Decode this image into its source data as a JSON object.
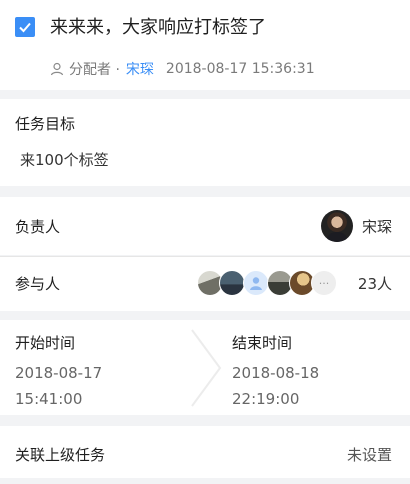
{
  "task": {
    "checked": true,
    "title": "来来来，大家响应打标签了",
    "assigner_label": "分配者 ·",
    "assigner_name": "宋琛",
    "created_at": "2018-08-17 15:36:31"
  },
  "goal": {
    "label": "任务目标",
    "text": "来100个标签"
  },
  "owner": {
    "label": "负责人",
    "name": "宋琛"
  },
  "participants": {
    "label": "参与人",
    "count_text": "23人",
    "more_glyph": "···"
  },
  "time": {
    "start_label": "开始时间",
    "start_date": "2018-08-17",
    "start_time": "15:41:00",
    "end_label": "结束时间",
    "end_date": "2018-08-18",
    "end_time": "22:19:00"
  },
  "parent_task": {
    "label": "关联上级任务",
    "value": "未设置"
  },
  "colors": {
    "accent": "#3a8ef6",
    "background": "#f2f3f5"
  }
}
